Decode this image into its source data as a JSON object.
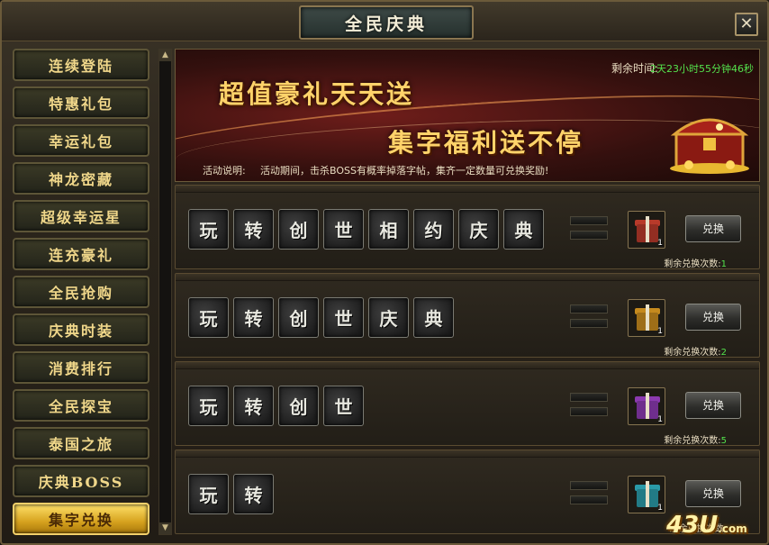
{
  "window": {
    "title": "全民庆典",
    "close_symbol": "✕"
  },
  "sidebar": {
    "items": [
      {
        "label": "连续登陆"
      },
      {
        "label": "特惠礼包"
      },
      {
        "label": "幸运礼包"
      },
      {
        "label": "神龙密藏"
      },
      {
        "label": "超级幸运星"
      },
      {
        "label": "连充豪礼"
      },
      {
        "label": "全民抢购"
      },
      {
        "label": "庆典时装"
      },
      {
        "label": "消费排行"
      },
      {
        "label": "全民探宝"
      },
      {
        "label": "泰国之旅"
      },
      {
        "label": "庆典BOSS"
      },
      {
        "label": "集字兑换",
        "active": true
      }
    ]
  },
  "banner": {
    "slogan_line1": "超值豪礼天天送",
    "slogan_line2": "集字福利送不停",
    "timer_label": "剩余时间:",
    "timer_value": "2天23小时55分钟46秒",
    "desc_label": "活动说明:",
    "desc_text": "活动期间，击杀BOSS有概率掉落字帖，集齐一定数量可兑换奖励!"
  },
  "redeem_rows": [
    {
      "chars": [
        "玩",
        "转",
        "创",
        "世",
        "相",
        "约",
        "庆",
        "典"
      ],
      "gift_qty": "1",
      "gift_color": "#b83a2a",
      "button": "兑换",
      "remain_label": "剩余兑换次数:",
      "remain_value": "1"
    },
    {
      "chars": [
        "玩",
        "转",
        "创",
        "世",
        "庆",
        "典"
      ],
      "gift_qty": "1",
      "gift_color": "#c58a1e",
      "button": "兑换",
      "remain_label": "剩余兑换次数:",
      "remain_value": "2"
    },
    {
      "chars": [
        "玩",
        "转",
        "创",
        "世"
      ],
      "gift_qty": "1",
      "gift_color": "#8b3ab0",
      "button": "兑换",
      "remain_label": "剩余兑换次数:",
      "remain_value": "5"
    },
    {
      "chars": [
        "玩",
        "转"
      ],
      "gift_qty": "1",
      "gift_color": "#2a9aa8",
      "button": "兑换",
      "remain_label": "剩余兑换次数:",
      "remain_value": ""
    }
  ],
  "watermark": {
    "text": "43U",
    "suffix": ".com"
  }
}
